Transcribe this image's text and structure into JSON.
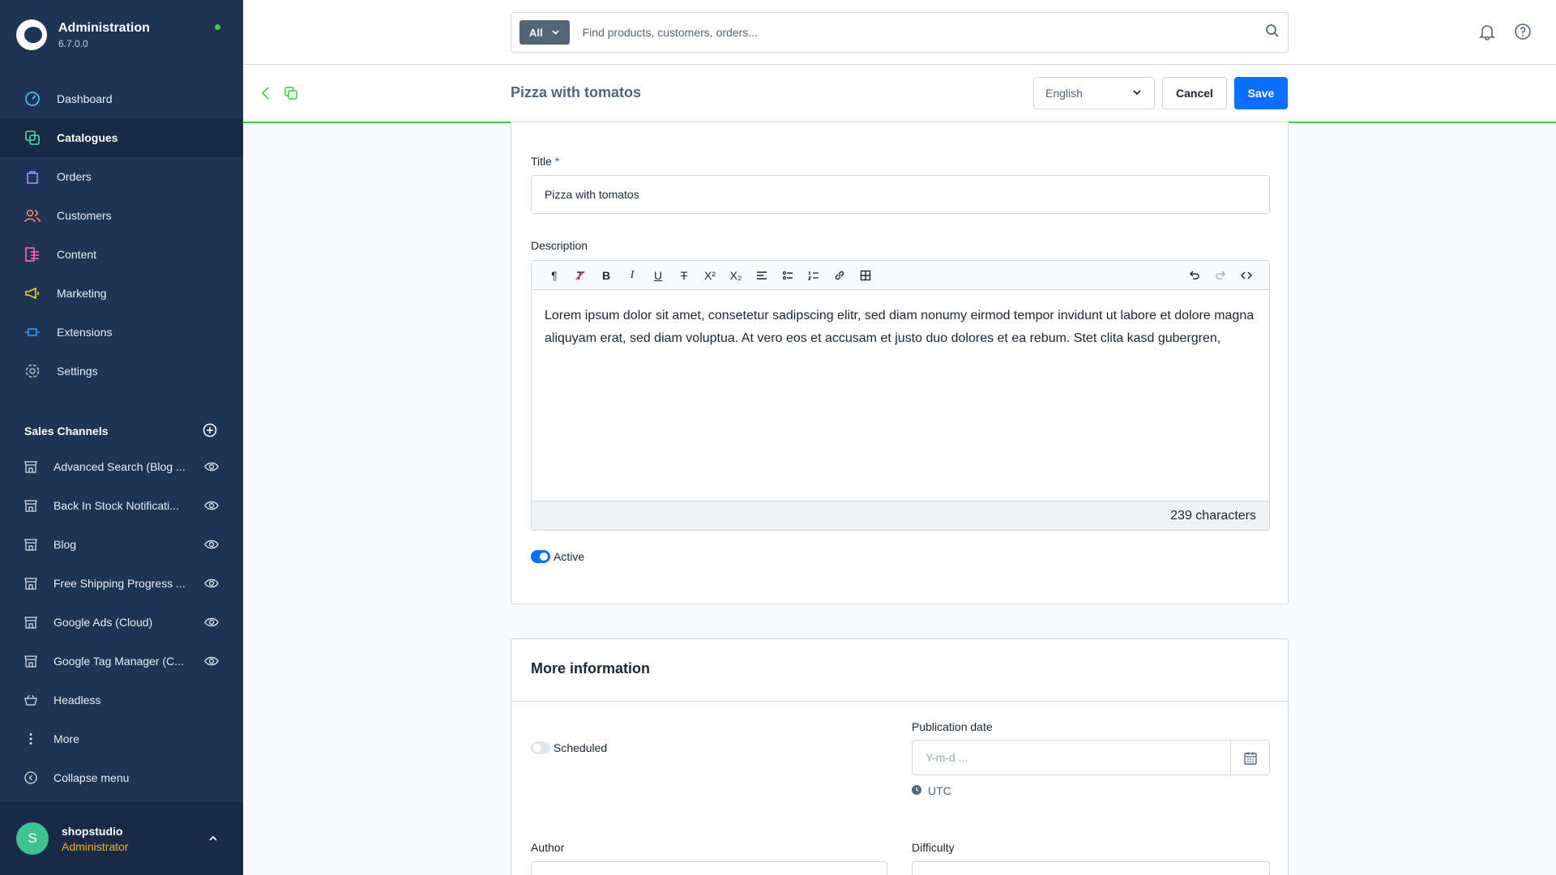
{
  "app": {
    "title": "Administration",
    "version": "6.7.0.0"
  },
  "nav": [
    {
      "label": "Dashboard",
      "icon": "dashboard-icon"
    },
    {
      "label": "Catalogues",
      "icon": "catalogue-icon"
    },
    {
      "label": "Orders",
      "icon": "orders-icon"
    },
    {
      "label": "Customers",
      "icon": "customers-icon"
    },
    {
      "label": "Content",
      "icon": "content-icon"
    },
    {
      "label": "Marketing",
      "icon": "marketing-icon"
    },
    {
      "label": "Extensions",
      "icon": "extensions-icon"
    },
    {
      "label": "Settings",
      "icon": "settings-icon"
    }
  ],
  "sales_channels": {
    "title": "Sales Channels",
    "items": [
      "Advanced Search (Blog ...",
      "Back In Stock Notificati...",
      "Blog",
      "Free Shipping Progress ...",
      "Google Ads (Cloud)",
      "Google Tag Manager (C...",
      "Headless"
    ],
    "more": "More",
    "collapse": "Collapse menu"
  },
  "user": {
    "initial": "S",
    "name": "shopstudio",
    "role": "Administrator"
  },
  "search": {
    "scope": "All",
    "placeholder": "Find products, customers, orders..."
  },
  "smartbar": {
    "title": "Pizza with tomatos",
    "language": "English",
    "cancel": "Cancel",
    "save": "Save"
  },
  "form": {
    "title_label": "Title",
    "required_mark": "*",
    "title_value": "Pizza with tomatos",
    "description_label": "Description",
    "description": "Lorem ipsum dolor sit amet, consetetur sadipscing elitr, sed diam nonumy eirmod tempor invidunt ut labore et dolore magna aliquyam erat, sed diam voluptua. At vero eos et accusam et justo duo dolores et ea rebum. Stet clita kasd gubergren,",
    "char_count": "239 characters",
    "active_label": "Active",
    "active": true
  },
  "more_info": {
    "title": "More information",
    "scheduled_label": "Scheduled",
    "scheduled": false,
    "pub_date_label": "Publication date",
    "pub_date_placeholder": "Y-m-d ...",
    "timezone": "UTC",
    "author_label": "Author",
    "difficulty_label": "Difficulty"
  },
  "colors": {
    "sidebar": "#1f3354",
    "accent": "#0870ff",
    "success": "#37d046",
    "role": "#ffab22"
  }
}
